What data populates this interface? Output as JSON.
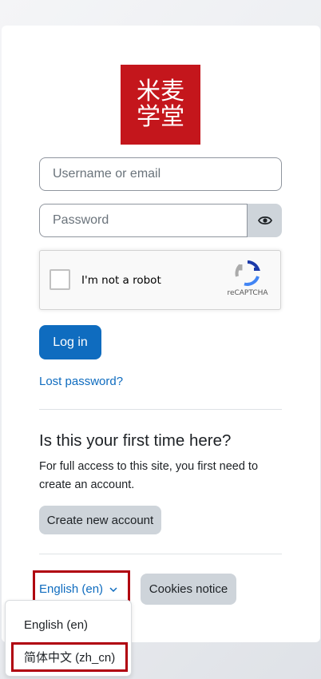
{
  "logo": {
    "line1": "米麦",
    "line2": "学堂"
  },
  "login": {
    "username_placeholder": "Username or email",
    "password_placeholder": "Password",
    "submit_label": "Log in",
    "lost_password": "Lost password?"
  },
  "captcha": {
    "label": "I'm not a robot",
    "brand": "reCAPTCHA"
  },
  "signup": {
    "heading": "Is this your first time here?",
    "text": "For full access to this site, you first need to create an account.",
    "button": "Create new account"
  },
  "footer": {
    "language_current": "English (en)",
    "cookies_label": "Cookies notice"
  },
  "language_menu": {
    "options": [
      "English (en)",
      "简体中文 (zh_cn)"
    ]
  },
  "colors": {
    "primary": "#0f6cbf",
    "brand_red": "#c4161c",
    "highlight": "#b0000f"
  },
  "icons": {
    "eye": "eye-icon",
    "chevron": "chevron-down-icon",
    "recaptcha": "recaptcha-logo-icon"
  }
}
